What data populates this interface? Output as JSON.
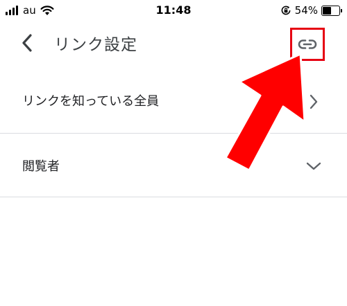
{
  "status_bar": {
    "carrier": "au",
    "time": "11:48",
    "battery_percent": "54%",
    "battery_level": 0.54
  },
  "header": {
    "title": "リンク設定",
    "back_icon": "chevron-left-icon",
    "link_icon": "link-icon"
  },
  "rows": [
    {
      "label": "リンクを知っている全員",
      "icon": "chevron-right-icon"
    },
    {
      "label": "閲覧者",
      "icon": "chevron-down-icon"
    }
  ],
  "colors": {
    "highlight": "#e60012",
    "arrow": "#ff0000",
    "divider": "#dadce0",
    "text": "#202124",
    "icon": "#5f6368"
  }
}
